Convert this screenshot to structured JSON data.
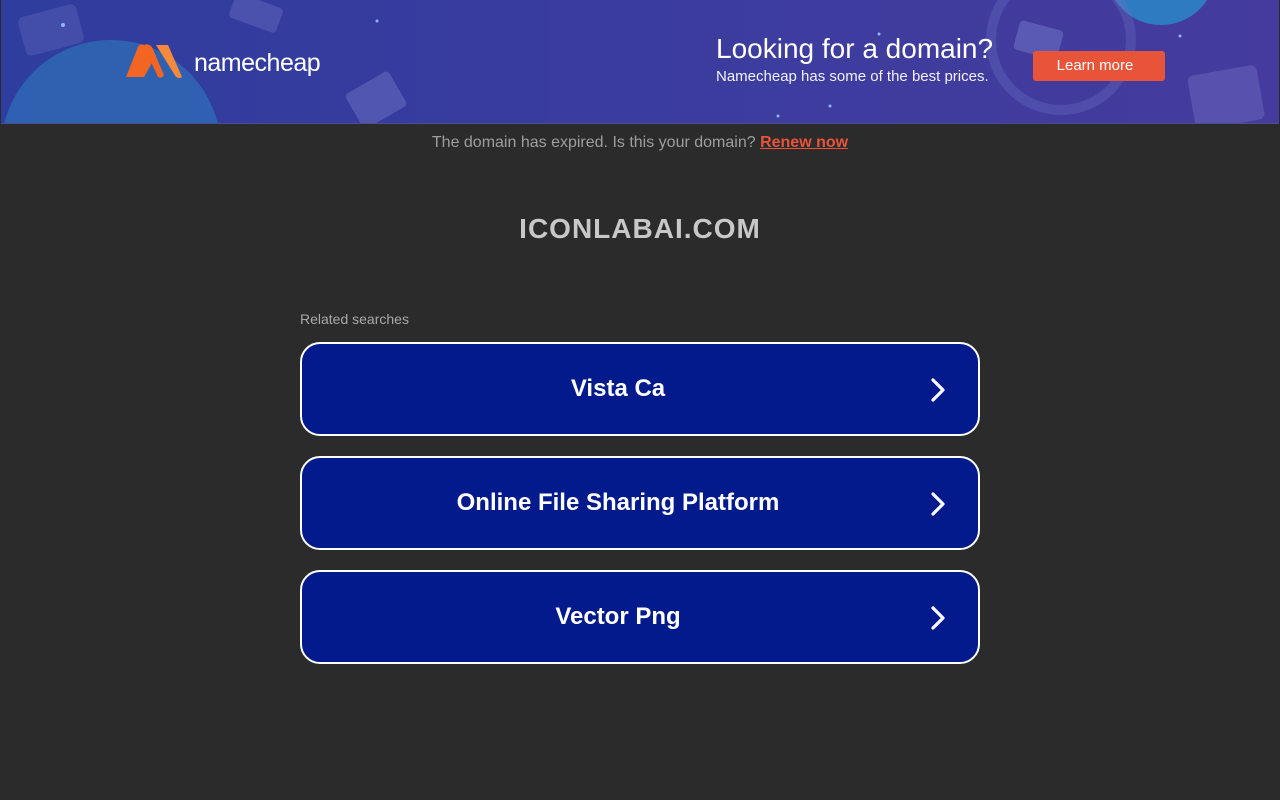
{
  "banner": {
    "logo_text": "namecheap",
    "title": "Looking for a domain?",
    "subtitle": "Namecheap has some of the best prices.",
    "button_label": "Learn more",
    "colors": {
      "background": "#3a3c9f",
      "button": "#e8543a",
      "logo_orange": "#f26522"
    }
  },
  "notice": {
    "text": "The domain has expired. Is this your domain?",
    "link_label": "Renew now"
  },
  "domain": "ICONLABAI.COM",
  "related": {
    "label": "Related searches",
    "items": [
      {
        "label": "Vista Ca",
        "icon": "chevron-right-icon"
      },
      {
        "label": "Online File Sharing Platform",
        "icon": "chevron-right-icon"
      },
      {
        "label": "Vector Png",
        "icon": "chevron-right-icon"
      }
    ]
  },
  "colors": {
    "page_background": "#2b2b2b",
    "link_background": "#021a8b",
    "renew_link": "#e8533b"
  }
}
